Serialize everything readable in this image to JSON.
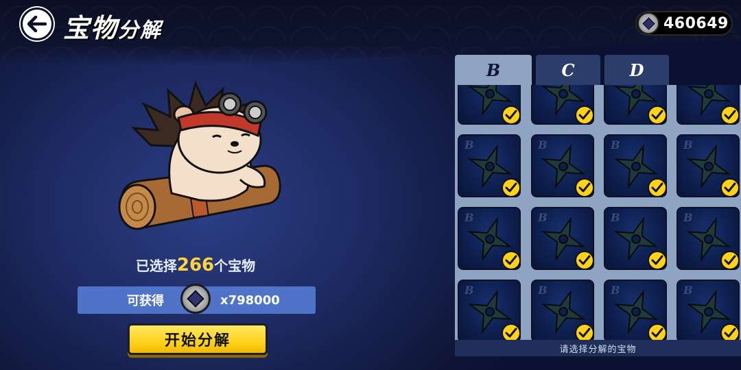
{
  "header": {
    "title_big": "宝物",
    "title_small": "分解",
    "currency_icon": "silver-coin-icon",
    "currency_amount": "460649"
  },
  "summary": {
    "selected_prefix": "已选择",
    "selected_count": "266",
    "selected_suffix": "个宝物",
    "reward_label": "可获得",
    "reward_amount": "x798000",
    "start_label": "开始分解"
  },
  "tabs": [
    {
      "label": "B",
      "active": true
    },
    {
      "label": "C",
      "active": false
    },
    {
      "label": "D",
      "active": false
    }
  ],
  "panel": {
    "hint": "请选择分解的宝物",
    "item_grade": "B",
    "item_icon": "shuriken-icon",
    "selected_icon": "checkmark-icon"
  },
  "colors": {
    "accent_yellow": "#ffd21a",
    "reward_bar": "#4f73c9",
    "tab_active": "#8fa3c3",
    "tab_inactive": "#2b3e6b"
  }
}
